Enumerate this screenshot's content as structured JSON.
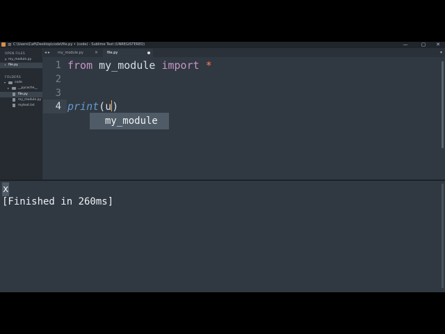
{
  "window": {
    "title": "C:\\Users\\Cafi\\Desktop\\code\\file.py • (code) - Sublime Text (UNREGISTERED)",
    "menu_icon": "≡",
    "minimize": "—",
    "maximize": "▢",
    "close": "✕"
  },
  "tabs": {
    "nav": "◂ ▸",
    "items": [
      {
        "label": "my_module.py",
        "close": "×",
        "active": false
      },
      {
        "label": "file.py",
        "close": "",
        "active": true,
        "dirty": true
      }
    ],
    "dropdown": "▾"
  },
  "sidebar": {
    "open_files_header": "OPEN FILES",
    "open_files": [
      {
        "close": "×",
        "label": "my_module.py",
        "selected": false
      },
      {
        "close": "•",
        "label": "file.py",
        "selected": true
      }
    ],
    "folders_header": "FOLDERS",
    "tree": [
      {
        "arrow": "▾",
        "label": "code",
        "type": "folder"
      },
      {
        "arrow": "▸",
        "label": "__pycache__",
        "type": "folder"
      },
      {
        "label": "file.py",
        "type": "file",
        "selected": true
      },
      {
        "label": "my_module.py",
        "type": "file"
      },
      {
        "label": "mytext.txt",
        "type": "file"
      }
    ]
  },
  "editor": {
    "line_numbers": [
      "1",
      "2",
      "3",
      "4"
    ],
    "active_line": "4",
    "line1": {
      "kw_from": "from",
      "module": "my_module",
      "kw_import": "import",
      "star": "*"
    },
    "line4": {
      "fn": "print",
      "open": "(",
      "arg": "u",
      "close": ")"
    },
    "autocomplete": [
      "my_module"
    ]
  },
  "output": {
    "line1": "x",
    "line2": "[Finished in 260ms]"
  },
  "colors": {
    "background": "#303841",
    "sidebar": "#252b31",
    "keyword": "#c695c6",
    "function": "#6699cc",
    "operator": "#f97b58",
    "caret": "#f9ae58"
  }
}
